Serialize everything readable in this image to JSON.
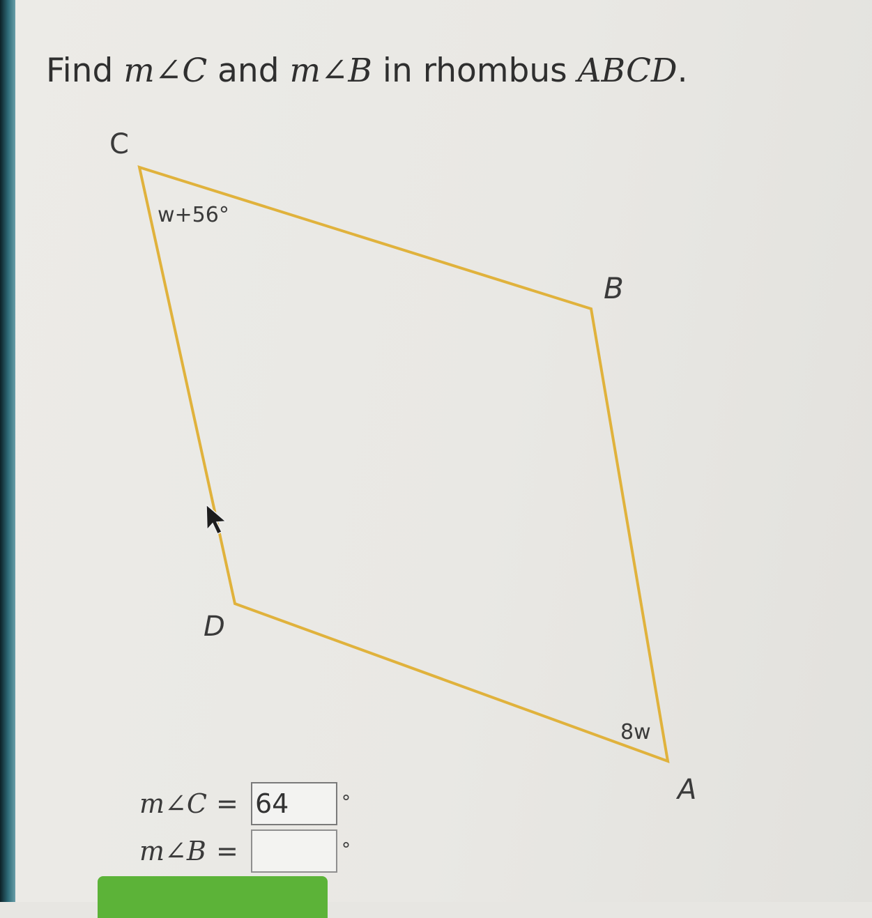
{
  "question": {
    "prefix": "Find ",
    "angle_c": "m∠C",
    "middle": " and ",
    "angle_b": "m∠B",
    "suffix_text": " in rhombus ",
    "shape_name": "ABCD",
    "period": "."
  },
  "figure": {
    "vertex_a": "A",
    "vertex_b": "B",
    "vertex_c": "C",
    "vertex_d": "D",
    "angle_c_expression": "w+56°",
    "angle_a_expression": "8w",
    "outline_color": "#e0b23c"
  },
  "answers": {
    "c_label": "m∠C",
    "c_equals": "=",
    "c_value": "64",
    "c_degree": "°",
    "b_label": "m∠B",
    "b_equals": "=",
    "b_value": "",
    "b_degree": "°"
  },
  "colors": {
    "submit_green": "#5cb338",
    "sidebar_teal": "#2e6c79"
  },
  "icons": {
    "cursor": "mouse-pointer-icon"
  }
}
